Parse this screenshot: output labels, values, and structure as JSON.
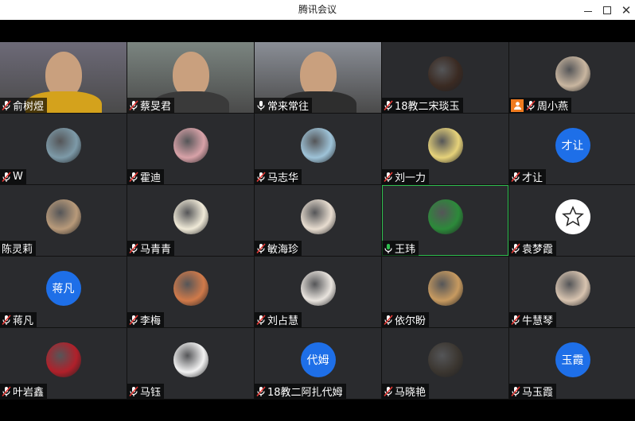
{
  "window": {
    "title": "腾讯会议",
    "minimize_icon": "minimize-icon",
    "maximize_icon": "maximize-icon",
    "close_icon": "close-icon"
  },
  "participants": [
    {
      "name": "俞树煜",
      "type": "video",
      "mic": "muted"
    },
    {
      "name": "蔡旻君",
      "type": "video",
      "mic": "muted"
    },
    {
      "name": "常来常往",
      "type": "video",
      "mic": "on"
    },
    {
      "name": "18教二宋琰玉",
      "type": "avatar",
      "mic": "muted",
      "avatar_color": "#3a2a22"
    },
    {
      "name": "周小燕",
      "type": "avatar",
      "mic": "muted",
      "host": true,
      "avatar_color": "#c9b6a0"
    },
    {
      "name": "W",
      "type": "avatar",
      "mic": "muted",
      "avatar_color": "#7d9aa8"
    },
    {
      "name": "霍迪",
      "type": "avatar",
      "mic": "muted",
      "avatar_color": "#d8a2a8"
    },
    {
      "name": "马志华",
      "type": "avatar",
      "mic": "muted",
      "avatar_color": "#9ec3d8"
    },
    {
      "name": "刘一力",
      "type": "avatar",
      "mic": "muted",
      "avatar_color": "#e6d27a"
    },
    {
      "name": "才让",
      "type": "text",
      "mic": "muted",
      "avatar_text": "才让"
    },
    {
      "name": "陈灵莉",
      "type": "avatar",
      "mic": "none",
      "avatar_color": "#b89a7a"
    },
    {
      "name": "马青青",
      "type": "avatar",
      "mic": "muted",
      "avatar_color": "#f0ead8"
    },
    {
      "name": "敏海珍",
      "type": "avatar",
      "mic": "muted",
      "avatar_color": "#e8ddd0"
    },
    {
      "name": "王玮",
      "type": "avatar",
      "mic": "on",
      "active": true,
      "avatar_color": "#2c8a3a"
    },
    {
      "name": "袁梦霞",
      "type": "avatar",
      "mic": "muted",
      "avatar_color": "#ffffff"
    },
    {
      "name": "蒋凡",
      "type": "text",
      "mic": "muted",
      "avatar_text": "蒋凡"
    },
    {
      "name": "李梅",
      "type": "avatar",
      "mic": "muted",
      "avatar_color": "#d07a4a"
    },
    {
      "name": "刘占慧",
      "type": "avatar",
      "mic": "muted",
      "avatar_color": "#e9e4de"
    },
    {
      "name": "依尔盼",
      "type": "avatar",
      "mic": "muted",
      "avatar_color": "#c79a60"
    },
    {
      "name": "牛慧琴",
      "type": "avatar",
      "mic": "muted",
      "avatar_color": "#d8c4b0"
    },
    {
      "name": "叶岩鑫",
      "type": "avatar",
      "mic": "muted",
      "avatar_color": "#b0202a"
    },
    {
      "name": "马钰",
      "type": "avatar",
      "mic": "muted",
      "avatar_color": "#f2f2f2"
    },
    {
      "name": "18教二阿扎代姆",
      "type": "text",
      "mic": "muted",
      "avatar_text": "代姆"
    },
    {
      "name": "马晓艳",
      "type": "avatar",
      "mic": "muted",
      "avatar_color": "#3b3630"
    },
    {
      "name": "马玉霞",
      "type": "text",
      "mic": "muted",
      "avatar_text": "玉霞"
    }
  ]
}
